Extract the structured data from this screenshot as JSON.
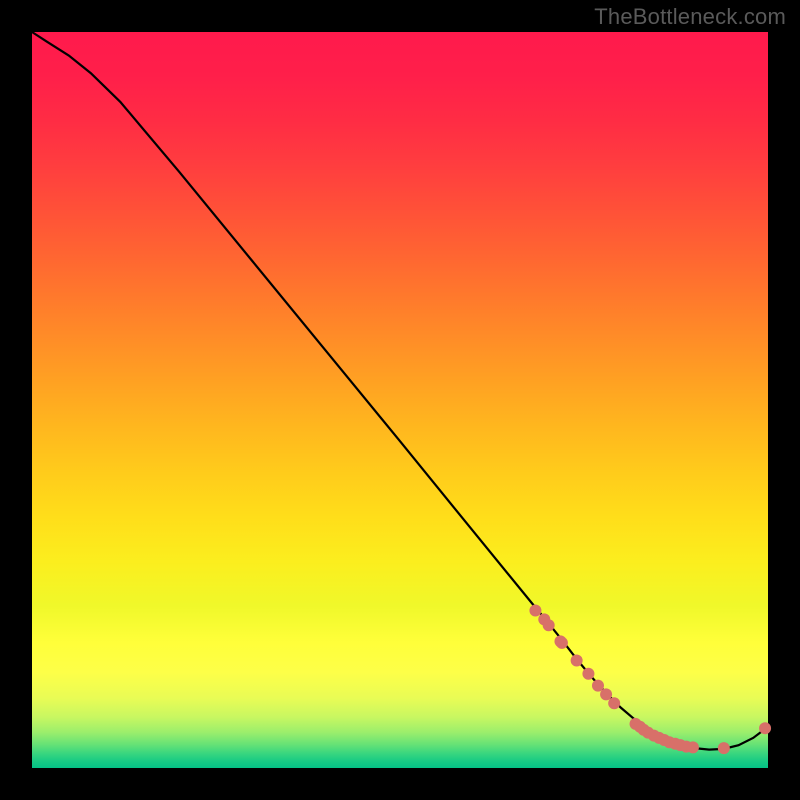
{
  "watermark": "TheBottleneck.com",
  "chart_data": {
    "type": "line",
    "title": "",
    "xlabel": "",
    "ylabel": "",
    "xlim": [
      0,
      1
    ],
    "ylim": [
      0,
      1
    ],
    "x": [
      0.0,
      0.02,
      0.05,
      0.08,
      0.12,
      0.2,
      0.3,
      0.4,
      0.5,
      0.6,
      0.68,
      0.7,
      0.72,
      0.74,
      0.76,
      0.78,
      0.8,
      0.82,
      0.84,
      0.86,
      0.88,
      0.9,
      0.92,
      0.94,
      0.96,
      0.98,
      1.0
    ],
    "y": [
      1.0,
      0.987,
      0.968,
      0.944,
      0.905,
      0.81,
      0.688,
      0.566,
      0.444,
      0.321,
      0.223,
      0.199,
      0.174,
      0.148,
      0.124,
      0.102,
      0.082,
      0.065,
      0.05,
      0.039,
      0.031,
      0.027,
      0.025,
      0.026,
      0.031,
      0.041,
      0.056
    ],
    "markers": [
      {
        "x": 0.684,
        "y": 0.214
      },
      {
        "x": 0.696,
        "y": 0.202
      },
      {
        "x": 0.702,
        "y": 0.194
      },
      {
        "x": 0.718,
        "y": 0.172
      },
      {
        "x": 0.72,
        "y": 0.17
      },
      {
        "x": 0.74,
        "y": 0.146
      },
      {
        "x": 0.756,
        "y": 0.128
      },
      {
        "x": 0.769,
        "y": 0.112
      },
      {
        "x": 0.78,
        "y": 0.1
      },
      {
        "x": 0.791,
        "y": 0.088
      },
      {
        "x": 0.82,
        "y": 0.06
      },
      {
        "x": 0.826,
        "y": 0.056
      },
      {
        "x": 0.831,
        "y": 0.052
      },
      {
        "x": 0.837,
        "y": 0.048
      },
      {
        "x": 0.845,
        "y": 0.044
      },
      {
        "x": 0.852,
        "y": 0.041
      },
      {
        "x": 0.859,
        "y": 0.038
      },
      {
        "x": 0.866,
        "y": 0.035
      },
      {
        "x": 0.874,
        "y": 0.033
      },
      {
        "x": 0.881,
        "y": 0.031
      },
      {
        "x": 0.889,
        "y": 0.029
      },
      {
        "x": 0.898,
        "y": 0.028
      },
      {
        "x": 0.94,
        "y": 0.027
      },
      {
        "x": 0.996,
        "y": 0.054
      }
    ],
    "gradient_stops": [
      {
        "offset": 0.0,
        "color": "#ff1a4c"
      },
      {
        "offset": 0.06,
        "color": "#ff1f4a"
      },
      {
        "offset": 0.12,
        "color": "#ff2c44"
      },
      {
        "offset": 0.18,
        "color": "#ff3d3f"
      },
      {
        "offset": 0.24,
        "color": "#ff5038"
      },
      {
        "offset": 0.3,
        "color": "#ff6432"
      },
      {
        "offset": 0.36,
        "color": "#ff792c"
      },
      {
        "offset": 0.42,
        "color": "#ff8e27"
      },
      {
        "offset": 0.48,
        "color": "#ffa322"
      },
      {
        "offset": 0.54,
        "color": "#ffb81e"
      },
      {
        "offset": 0.6,
        "color": "#ffcc1b"
      },
      {
        "offset": 0.66,
        "color": "#ffde1a"
      },
      {
        "offset": 0.72,
        "color": "#fbee1e"
      },
      {
        "offset": 0.78,
        "color": "#f0f82a"
      },
      {
        "offset": 0.83,
        "color": "#ffff3a"
      },
      {
        "offset": 0.87,
        "color": "#fdff48"
      },
      {
        "offset": 0.905,
        "color": "#e9fc55"
      },
      {
        "offset": 0.931,
        "color": "#c8f761"
      },
      {
        "offset": 0.952,
        "color": "#9aee6c"
      },
      {
        "offset": 0.968,
        "color": "#66e276"
      },
      {
        "offset": 0.981,
        "color": "#36d57f"
      },
      {
        "offset": 0.991,
        "color": "#17ca84"
      },
      {
        "offset": 1.0,
        "color": "#05c286"
      }
    ],
    "marker_color": "#d87069",
    "line_color": "#000000"
  }
}
